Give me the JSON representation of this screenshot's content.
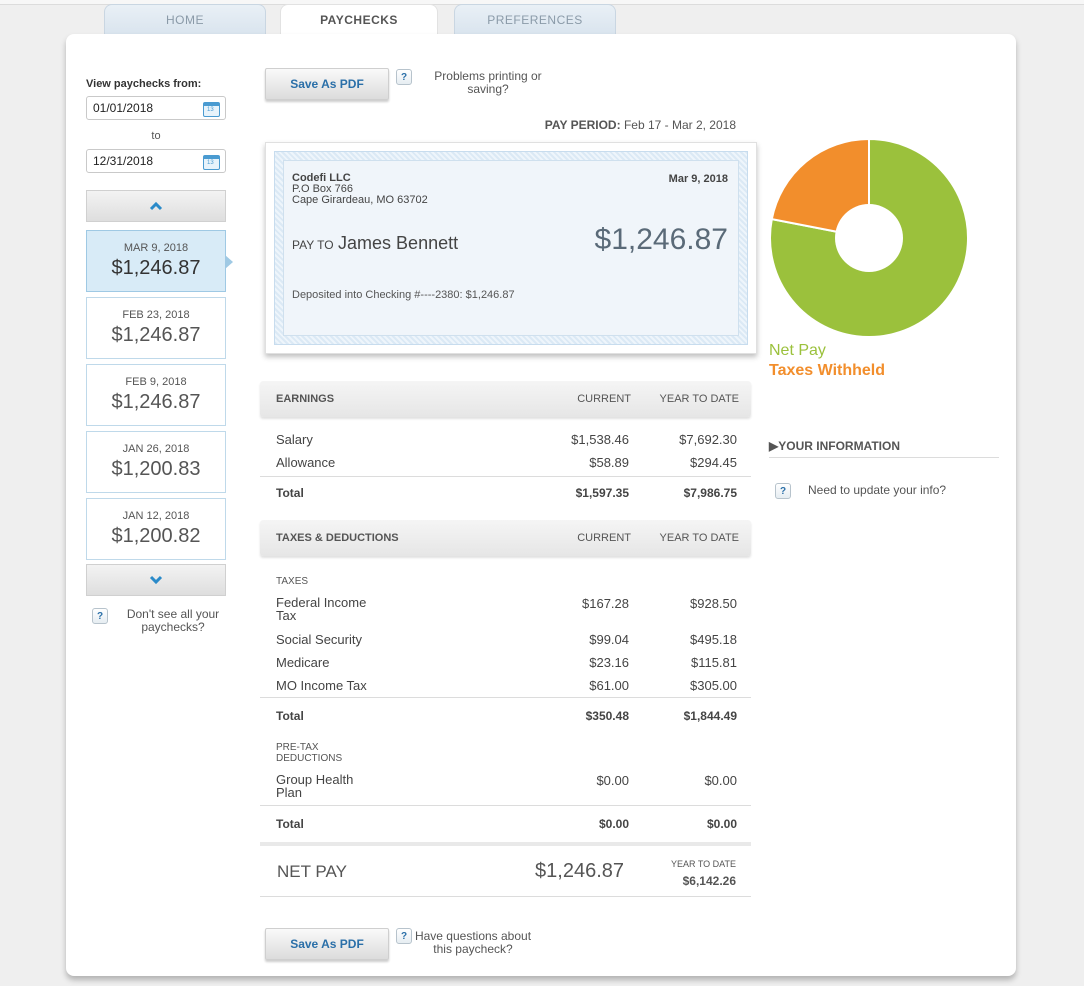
{
  "tabs": [
    {
      "label": "HOME"
    },
    {
      "label": "PAYCHECKS"
    },
    {
      "label": "PREFERENCES"
    }
  ],
  "sidebar": {
    "view_label": "View paychecks from:",
    "from_date": "01/01/2018",
    "to_label": "to",
    "to_date": "12/31/2018",
    "calendar_icon_text": "13",
    "paychecks": [
      {
        "date": "MAR 9, 2018",
        "amount": "$1,246.87",
        "selected": true
      },
      {
        "date": "FEB 23, 2018",
        "amount": "$1,246.87"
      },
      {
        "date": "FEB 9, 2018",
        "amount": "$1,246.87"
      },
      {
        "date": "JAN 26, 2018",
        "amount": "$1,200.83"
      },
      {
        "date": "JAN 12, 2018",
        "amount": "$1,200.82"
      }
    ],
    "help_text": "Don't see all your paychecks?"
  },
  "toolbar": {
    "save_pdf": "Save As PDF",
    "help_mark": "?",
    "problems_text": "Problems printing or saving?"
  },
  "pay_period": {
    "label": "PAY PERIOD:",
    "value": "Feb 17 - Mar 2, 2018"
  },
  "check": {
    "company": "Codefi LLC",
    "address1": "P.O Box 766",
    "address2": "Cape Girardeau, MO 63702",
    "date": "Mar 9, 2018",
    "pay_to_label": "PAY TO",
    "payee": "James Bennett",
    "amount": "$1,246.87",
    "deposit_text": "Deposited into Checking #----2380:  $1,246.87"
  },
  "earnings": {
    "header": "EARNINGS",
    "col_current": "CURRENT",
    "col_ytd": "YEAR TO DATE",
    "rows": [
      {
        "name": "Salary",
        "current": "$1,538.46",
        "ytd": "$7,692.30"
      },
      {
        "name": "Allowance",
        "current": "$58.89",
        "ytd": "$294.45"
      }
    ],
    "total": {
      "name": "Total",
      "current": "$1,597.35",
      "ytd": "$7,986.75"
    }
  },
  "taxes": {
    "header": "TAXES & DEDUCTIONS",
    "col_current": "CURRENT",
    "col_ytd": "YEAR TO DATE",
    "taxes_label": "TAXES",
    "rows": [
      {
        "name": "Federal Income Tax",
        "current": "$167.28",
        "ytd": "$928.50"
      },
      {
        "name": "Social Security",
        "current": "$99.04",
        "ytd": "$495.18"
      },
      {
        "name": "Medicare",
        "current": "$23.16",
        "ytd": "$115.81"
      },
      {
        "name": "MO Income Tax",
        "current": "$61.00",
        "ytd": "$305.00"
      }
    ],
    "total": {
      "name": "Total",
      "current": "$350.48",
      "ytd": "$1,844.49"
    },
    "pretax_label": "PRE-TAX DEDUCTIONS",
    "pretax_rows": [
      {
        "name": "Group Health Plan",
        "current": "$0.00",
        "ytd": "$0.00"
      }
    ],
    "pretax_total": {
      "name": "Total",
      "current": "$0.00",
      "ytd": "$0.00"
    }
  },
  "net_pay": {
    "label": "NET PAY",
    "amount": "$1,246.87",
    "ytd_label": "YEAR TO DATE",
    "ytd_amount": "$6,142.26"
  },
  "footer": {
    "save_pdf": "Save As PDF",
    "questions_text": "Have questions about this paycheck?"
  },
  "chart": {
    "legend": [
      {
        "name": "Net Pay",
        "color": "#9bc13c"
      },
      {
        "name": "Taxes Withheld",
        "color": "#f28e2c"
      }
    ]
  },
  "chart_data": {
    "type": "pie",
    "categories": [
      "Net Pay",
      "Taxes Withheld"
    ],
    "values": [
      1246.87,
      350.48
    ],
    "colors": [
      "#9bc13c",
      "#f28e2c"
    ],
    "donut": true
  },
  "your_info": {
    "header": "▶YOUR INFORMATION",
    "help_text": "Need to update your info?"
  }
}
